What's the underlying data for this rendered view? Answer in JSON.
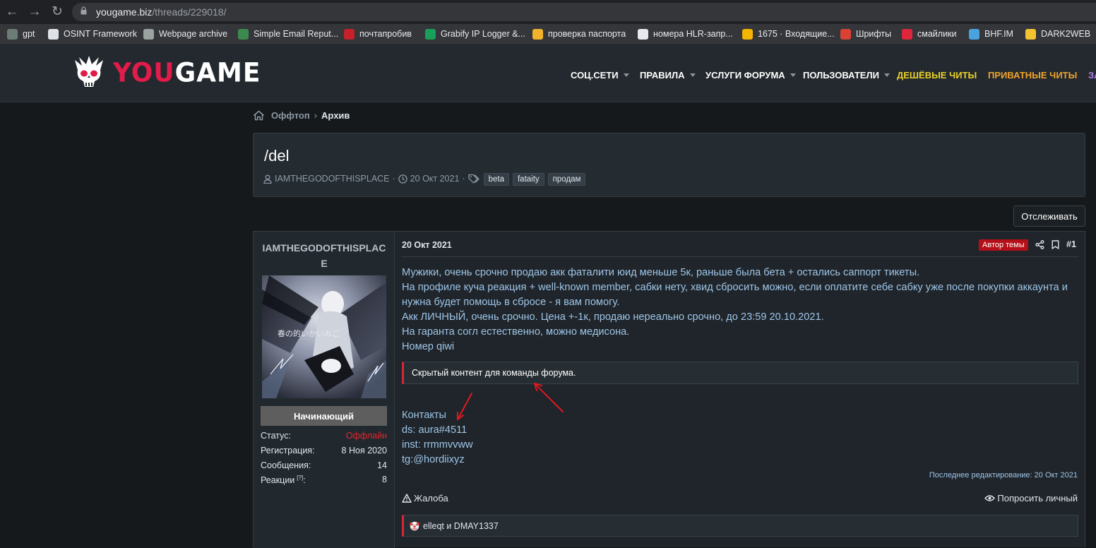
{
  "browser": {
    "url_host": "yougame.biz",
    "url_path": "/threads/229018/",
    "bookmarks": [
      {
        "label": "gpt",
        "color": "#6b7d74"
      },
      {
        "label": "OSINT Framework",
        "color": "#dfe3e8"
      },
      {
        "label": "Webpage archive",
        "color": "#9aa3a0"
      },
      {
        "label": "Simple Email Reput...",
        "color": "#3c8a4f"
      },
      {
        "label": "почтапробив",
        "color": "#c7202a"
      },
      {
        "label": "Grabify IP Logger &...",
        "color": "#18a05a"
      },
      {
        "label": "проверка паспорта",
        "color": "#f2b32a"
      },
      {
        "label": "номера HLR-запр...",
        "color": "#e8eaed"
      },
      {
        "label": "1675 · Входящие...",
        "color": "#f4b400"
      },
      {
        "label": "Шрифты",
        "color": "#d84134"
      },
      {
        "label": "смайлики",
        "color": "#e0263b"
      },
      {
        "label": "BHF.IM",
        "color": "#4aa3df"
      },
      {
        "label": "DARK2WEB",
        "color": "#f4c430"
      }
    ]
  },
  "site": {
    "logo_you": "YOU",
    "logo_game": "GAME",
    "nav": [
      {
        "label": "СОЦ.СЕТИ",
        "color": "#ffffff",
        "caret": true
      },
      {
        "label": "ПРАВИЛА",
        "color": "#ffffff",
        "caret": true
      },
      {
        "label": "УСЛУГИ ФОРУМА",
        "color": "#ffffff",
        "caret": true
      },
      {
        "label": "ПОЛЬЗОВАТЕЛИ",
        "color": "#ffffff",
        "caret": true
      },
      {
        "label": "ДЕШЁВЫЕ ЧИТЫ",
        "color": "#e8d22a",
        "caret": false
      },
      {
        "label": "ПРИВАТНЫЕ ЧИТЫ",
        "color": "#f0a32c",
        "caret": false
      },
      {
        "label": "ЗА",
        "color": "#b37fe3",
        "caret": false
      }
    ]
  },
  "breadcrumb": {
    "parent": "Оффтоп",
    "current": "Архив"
  },
  "thread": {
    "title": "/del",
    "author": "IAMTHEGODOFTHISPLACE",
    "date": "20 Окт 2021",
    "tags": [
      "beta",
      "fataity",
      "продам"
    ],
    "follow_label": "Отслеживать"
  },
  "post": {
    "username": "IAMTHEGODOFTHISPLACE",
    "avatar_caption": "春の的いかいおご",
    "rank": "Начинающий",
    "stats": [
      {
        "label": "Статус:",
        "value": "Оффлайн",
        "offline": true
      },
      {
        "label": "Регистрация:",
        "value": "8 Ноя 2020",
        "offline": false
      },
      {
        "label": "Сообщения:",
        "value": "14",
        "offline": false
      },
      {
        "label": "Реакции",
        "sup": "[?]",
        "value": "8",
        "offline": false
      }
    ],
    "date": "20 Окт 2021",
    "author_badge": "Автор темы",
    "number": "#1",
    "body_lines": [
      "Мужики, очень срочно продаю акк фаталити юид меньше 5к, раньше была бета + остались саппорт тикеты.",
      "На профиле куча реакция + well-known member, сабки нету, хвид сбросить можно, если оплатите себе сабку уже после покупки аккаунта и нужна будет помощь в сбросе - я вам помогу.",
      "Акк ЛИЧНЫЙ, очень срочно. Цена +-1к, продаю нереально срочно, до 23:59 20.10.2021.",
      "На гаранта согл естественно, можно медисона.",
      "Номер qiwi"
    ],
    "hidden_content": "Скрытый контент для команды форума.",
    "contacts": [
      "Контакты",
      "ds: aura#4511",
      "inst: rrmmvvww",
      "tg:@hordiixyz"
    ],
    "last_edited": "Последнее редактирование: 20 Окт 2021",
    "complaint_label": "Жалоба",
    "request_label": "Попросить личный",
    "reactions": "elleqt и DMAY1337"
  }
}
